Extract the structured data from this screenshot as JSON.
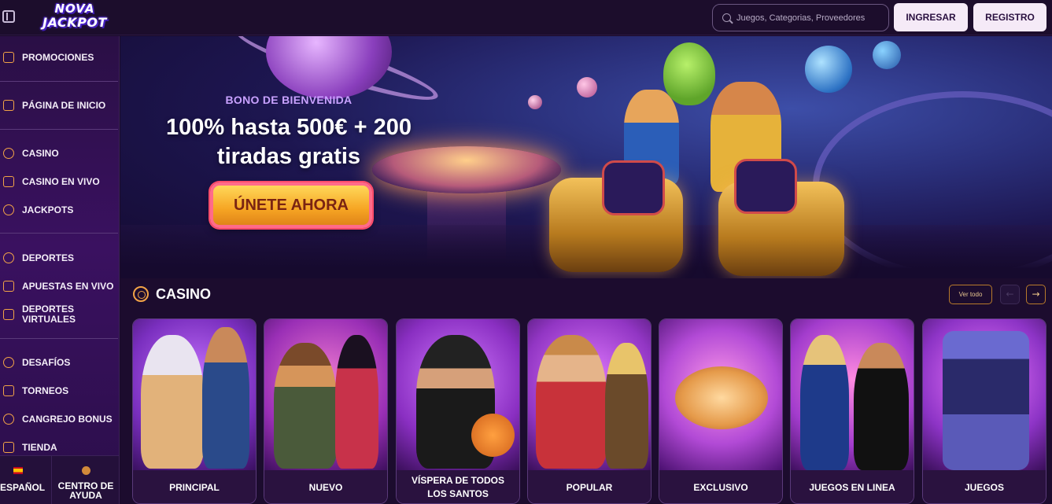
{
  "header": {
    "logo_line1": "NOVA",
    "logo_line2": "JACKPOT",
    "search_placeholder": "Juegos, Categorias, Proveedores",
    "login_label": "INGRESAR",
    "register_label": "REGISTRO"
  },
  "sidebar": {
    "items": [
      {
        "label": "PROMOCIONES",
        "icon": "gift-icon"
      },
      {
        "label": "PÁGINA DE INICIO",
        "icon": "home-icon"
      },
      {
        "label": "CASINO",
        "icon": "chip-icon"
      },
      {
        "label": "CASINO EN VIVO",
        "icon": "spade-icon"
      },
      {
        "label": "JACKPOTS",
        "icon": "seven-icon"
      },
      {
        "label": "DEPORTES",
        "icon": "ball-icon"
      },
      {
        "label": "APUESTAS EN VIVO",
        "icon": "play-icon"
      },
      {
        "label": "DEPORTES VIRTUALES",
        "icon": "gamepad-icon"
      },
      {
        "label": "DESAFÍOS",
        "icon": "medal-icon"
      },
      {
        "label": "TORNEOS",
        "icon": "trophy-icon"
      },
      {
        "label": "CANGREJO BONUS",
        "icon": "crab-icon"
      },
      {
        "label": "TIENDA",
        "icon": "store-icon"
      }
    ],
    "language_label": "ESPAÑOL",
    "help_label": "CENTRO DE AYUDA"
  },
  "hero": {
    "subtitle": "BONO DE BIENVENIDA",
    "title": "100% hasta 500€ + 200 tiradas gratis",
    "cta_label": "ÚNETE AHORA"
  },
  "casino": {
    "title": "CASINO",
    "view_all_label": "Ver todo",
    "prev_arrow": "←",
    "next_arrow": "→",
    "cards": [
      {
        "label": "PRINCIPAL",
        "bg": "#7a2fbf"
      },
      {
        "label": "NUEVO",
        "bg": "#9a2fb6"
      },
      {
        "label": "VÍSPERA DE TODOS LOS SANTOS",
        "bg": "#8a2fc2"
      },
      {
        "label": "POPULAR",
        "bg": "#9236c4"
      },
      {
        "label": "EXCLUSIVO",
        "bg": "#b24ad6"
      },
      {
        "label": "JUEGOS EN LINEA",
        "bg": "#a33ccd"
      },
      {
        "label": "JUEGOS",
        "bg": "#8d34c6"
      }
    ]
  },
  "colors": {
    "accent": "#f2a347",
    "sidebar_bg": "#2a0f45",
    "header_bg": "#1c0d2c",
    "button_light": "#f5eaf7"
  }
}
